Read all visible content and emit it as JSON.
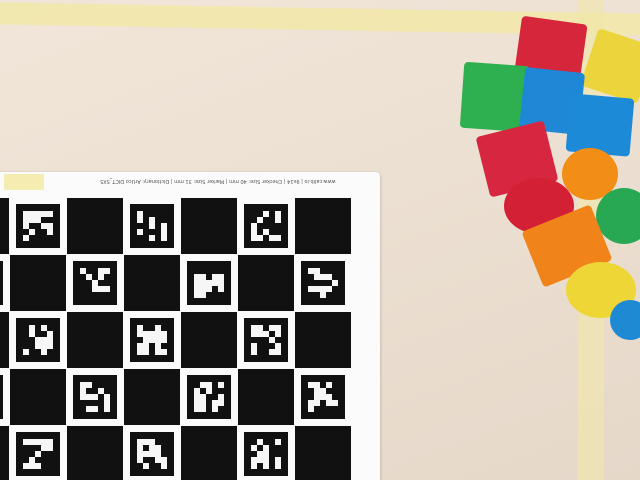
{
  "scene": {
    "description_visible_text": "www.calib.io | 9x14 | Checker Size: 40 mm | Marker Size: 31 mm | Dictionary: ArUco DICT_5X5",
    "board_color": "#fbfbfb",
    "table_color": "#ece0d2",
    "tape_color": "#f1e7a8"
  }
}
